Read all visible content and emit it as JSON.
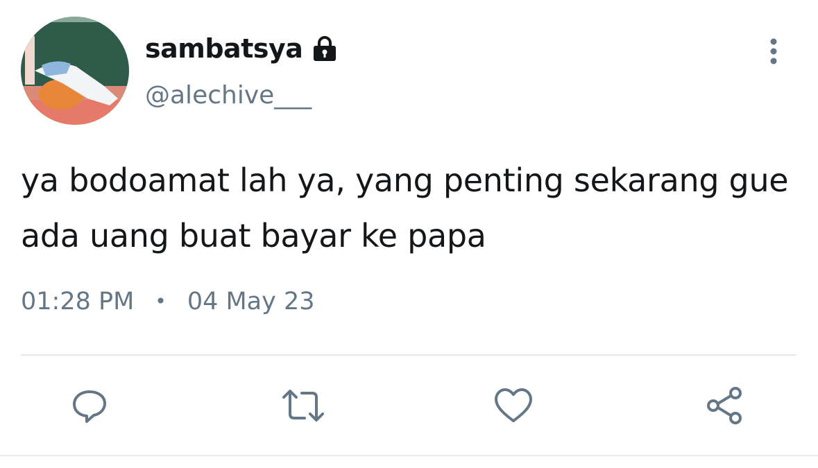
{
  "user": {
    "display_name": "sambatsya",
    "handle": "@alechive___",
    "protected_icon": "lock-icon",
    "avatar": "avatar-photo"
  },
  "tweet": {
    "text": "ya bodoamat lah ya, yang penting sekarang gue ada uang buat bayar ke papa",
    "time": "01:28 PM",
    "separator": "•",
    "date": "04 May 23"
  },
  "actions": [
    {
      "icon": "reply-icon"
    },
    {
      "icon": "retweet-icon"
    },
    {
      "icon": "like-icon"
    },
    {
      "icon": "share-icon"
    }
  ],
  "menu": {
    "icon": "more-options-icon"
  },
  "colors": {
    "text_primary": "#14171a",
    "text_secondary": "#657786",
    "icon": "#657786",
    "divider": "#e1e8ed"
  }
}
